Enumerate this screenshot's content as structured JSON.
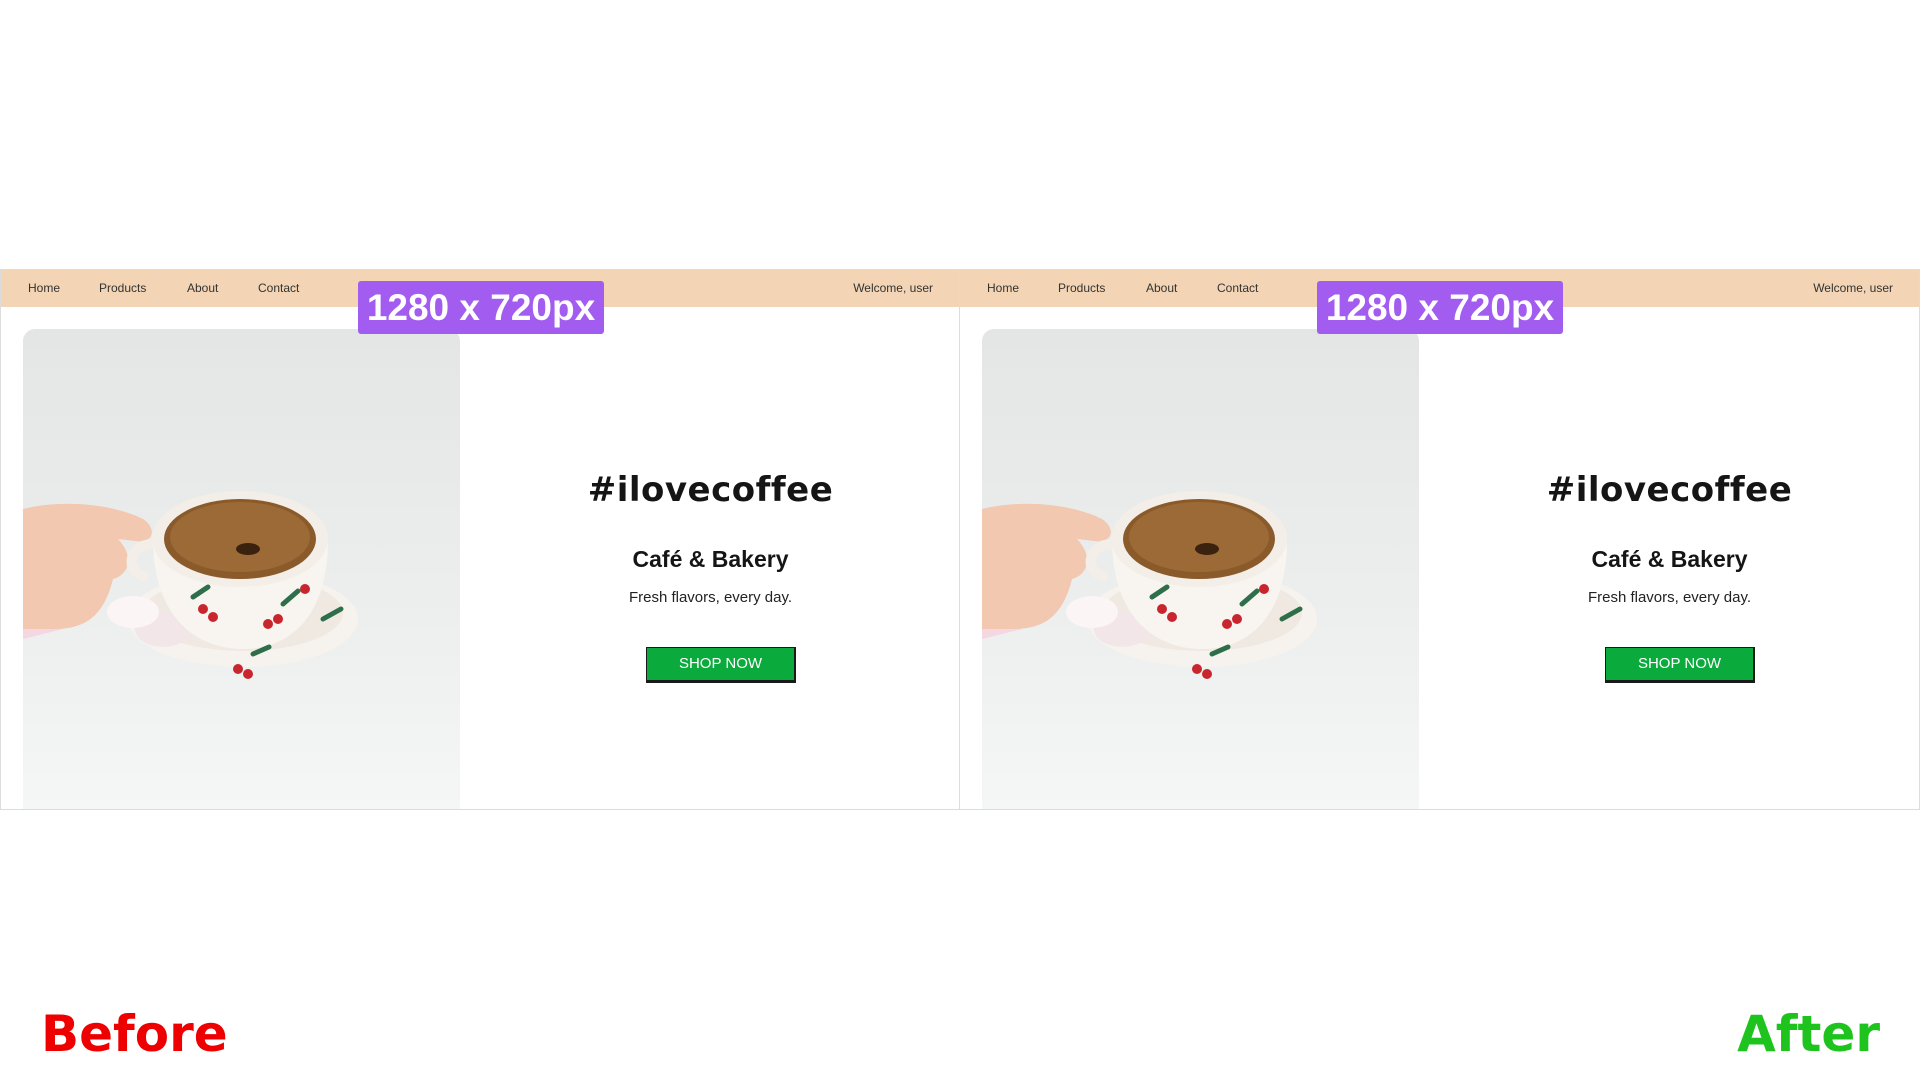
{
  "panels": [
    {
      "nav": {
        "items": [
          "Home",
          "Products",
          "About",
          "Contact"
        ],
        "welcome": "Welcome, user"
      },
      "badge": "1280 x 720px",
      "hero": {
        "hashtag": "#ilovecoffee",
        "subtitle": "Café & Bakery",
        "tagline": "Fresh flavors, every day.",
        "cta": "SHOP NOW"
      },
      "image_icon": "coffee-cup-photo"
    },
    {
      "nav": {
        "items": [
          "Home",
          "Products",
          "About",
          "Contact"
        ],
        "welcome": "Welcome, user"
      },
      "badge": "1280 x 720px",
      "hero": {
        "hashtag": "#ilovecoffee",
        "subtitle": "Café & Bakery",
        "tagline": "Fresh flavors, every day.",
        "cta": "SHOP NOW"
      },
      "image_icon": "coffee-cup-photo"
    }
  ],
  "captions": {
    "before": "Before",
    "after": "After"
  },
  "colors": {
    "navbar": "#f3d4b4",
    "badge": "#a25df0",
    "cta": "#0aaa3c",
    "before_label": "#ee0000",
    "after_label": "#1ec31e"
  }
}
